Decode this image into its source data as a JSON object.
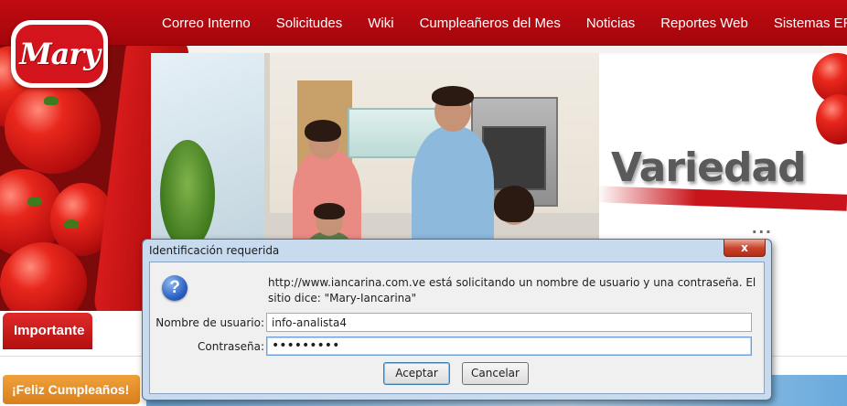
{
  "nav": {
    "items": [
      {
        "label": "Correo Interno"
      },
      {
        "label": "Solicitudes"
      },
      {
        "label": "Wiki"
      },
      {
        "label": "Cumpleañeros del Mes"
      },
      {
        "label": "Noticias"
      },
      {
        "label": "Reportes Web"
      },
      {
        "label": "Sistemas ERP"
      }
    ]
  },
  "brand": {
    "logo_text": "Mary",
    "primary_color": "#c20a12"
  },
  "banner": {
    "headline": "Variedad",
    "trailing_dots": "...",
    "accent_color": "#c8141a"
  },
  "sections": {
    "importante_label": "Importante",
    "birthday_label": "¡Feliz Cumpleaños!"
  },
  "dialog": {
    "title": "Identificación requerida",
    "close_glyph": "x",
    "message": "http://www.iancarina.com.ve está solicitando un nombre de usuario y una contraseña. El sitio dice: \"Mary-Iancarina\"",
    "username_label": "Nombre de usuario:",
    "username_value": "info-analista4",
    "password_label": "Contraseña:",
    "password_value": "•••••••••",
    "accept_label": "Aceptar",
    "cancel_label": "Cancelar",
    "icon": "question-icon",
    "title_color": "#c8daee"
  }
}
